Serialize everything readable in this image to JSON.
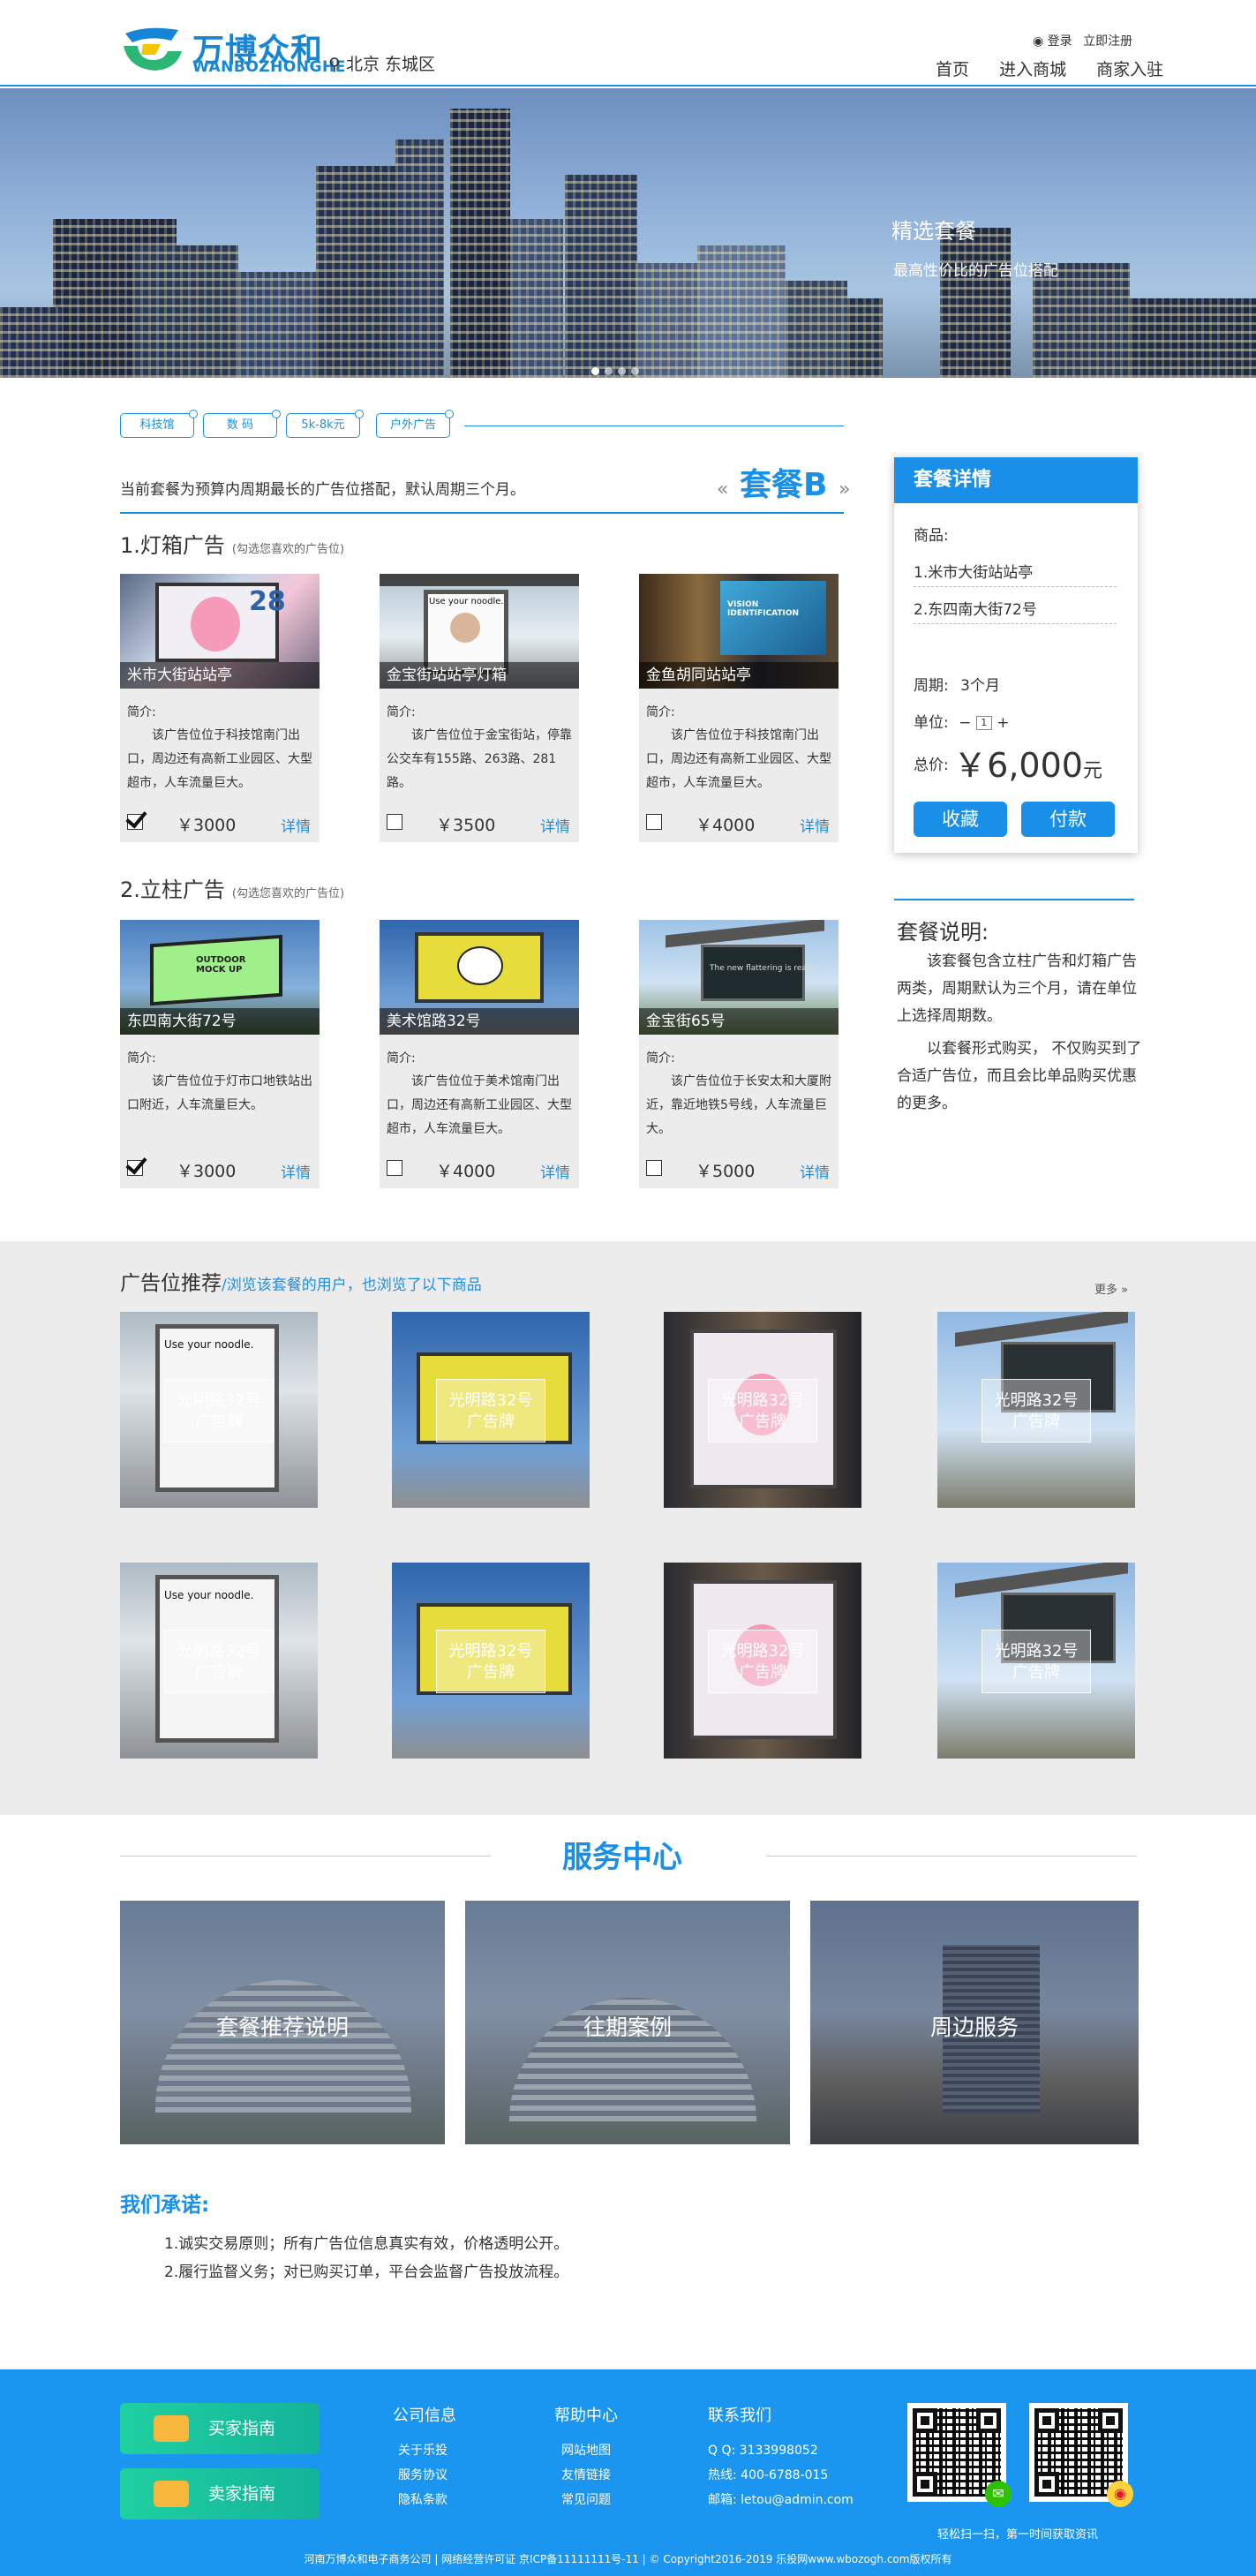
{
  "header": {
    "logo_cn": "万博众和",
    "logo_en": "WANBOZHONGHE",
    "location": "北京 东城区",
    "login": "登录",
    "register": "立即注册",
    "nav": [
      "首页",
      "进入商城",
      "商家入驻"
    ]
  },
  "banner": {
    "title": "精选套餐",
    "subtitle": "最高性价比的广告位搭配"
  },
  "tags": [
    "科技馆",
    "数 码",
    "5k-8k元",
    "户外广告"
  ],
  "package": {
    "intro": "当前套餐为预算内周期最长的广告位搭配，默认周期三个月。",
    "name": "套餐B",
    "quote_left": "«",
    "quote_right": "»"
  },
  "section1": {
    "title": "1.灯箱广告",
    "hint": "(勾选您喜欢的广告位)",
    "cards": [
      {
        "caption": "米市大街站站亭",
        "label": "简介:",
        "desc": "该广告位位于科技馆南门出口，周边还有高新工业园区、大型超市，人车流量巨大。",
        "price": "￥3000",
        "more": "详情",
        "checked": true
      },
      {
        "caption": "金宝街站站亭灯箱",
        "label": "简介:",
        "desc": "该广告位位于金宝街站，停靠公交车有155路、263路、281路。",
        "price": "￥3500",
        "more": "详情",
        "checked": false
      },
      {
        "caption": "金鱼胡同站站亭",
        "label": "简介:",
        "desc": "该广告位位于科技馆南门出口，周边还有高新工业园区、大型超市，人车流量巨大。",
        "price": "￥4000",
        "more": "详情",
        "checked": false
      }
    ]
  },
  "section2": {
    "title": "2.立柱广告",
    "hint": "(勾选您喜欢的广告位)",
    "cards": [
      {
        "caption": "东四南大街72号",
        "label": "简介:",
        "desc": "该广告位位于灯市口地铁站出口附近，人车流量巨大。",
        "price": "￥3000",
        "more": "详情",
        "checked": true
      },
      {
        "caption": "美术馆路32号",
        "label": "简介:",
        "desc": "该广告位位于美术馆南门出口，周边还有高新工业园区、大型超市，人车流量巨大。",
        "price": "￥4000",
        "more": "详情",
        "checked": false
      },
      {
        "caption": "金宝街65号",
        "label": "简介:",
        "desc": "该广告位位于长安太和大厦附近，靠近地铁5号线，人车流量巨大。",
        "price": "￥5000",
        "more": "详情",
        "checked": false
      }
    ]
  },
  "detail": {
    "title": "套餐详情",
    "goods_label": "商品:",
    "goods": [
      "1.米市大街站站亭",
      "2.东四南大街72号"
    ],
    "period_label": "周期:",
    "period": "3个月",
    "unit_label": "单位:",
    "unit_minus": "−",
    "unit_value": "1",
    "unit_plus": "+",
    "total_label": "总价:",
    "total": "￥6,000",
    "total_unit": "元",
    "collect": "收藏",
    "pay": "付款"
  },
  "notes": {
    "title": "套餐说明:",
    "p1": "该套餐包含立柱广告和灯箱广告两类，周期默认为三个月，请在单位上选择周期数。",
    "p2": "以套餐形式购买， 不仅购买到了合适广告位，而且会比单品购买优惠的更多。"
  },
  "recommend": {
    "title": "广告位推荐",
    "subtitle": "/浏览该套餐的用户，也浏览了以下商品",
    "more": "更多 »",
    "items": [
      {
        "line1": "光明路32号",
        "line2": "广告牌"
      },
      {
        "line1": "光明路32号",
        "line2": "广告牌"
      },
      {
        "line1": "光明路32号",
        "line2": "广告牌"
      },
      {
        "line1": "光明路32号",
        "line2": "广告牌"
      },
      {
        "line1": "光明路32号",
        "line2": "广告牌"
      },
      {
        "line1": "光明路32号",
        "line2": "广告牌"
      },
      {
        "line1": "光明路32号",
        "line2": "广告牌"
      },
      {
        "line1": "光明路32号",
        "line2": "广告牌"
      }
    ]
  },
  "service": {
    "title": "服务中心",
    "items": [
      "套餐推荐说明",
      "往期案例",
      "周边服务"
    ]
  },
  "promise": {
    "title": "我们承诺:",
    "items": [
      "1.诚实交易原则；所有广告位信息真实有效，价格透明公开。",
      "2.履行监督义务；对已购买订单，平台会监督广告投放流程。"
    ]
  },
  "footer": {
    "buyer_guide": "买家指南",
    "seller_guide": "卖家指南",
    "col1": {
      "title": "公司信息",
      "items": [
        "关于乐投",
        "服务协议",
        "隐私条款"
      ]
    },
    "col2": {
      "title": "帮助中心",
      "items": [
        "网站地图",
        "友情链接",
        "常见问题"
      ]
    },
    "col3": {
      "title": "联系我们",
      "items": [
        "Q Q:  3133998052",
        "热线:  400-6788-015",
        "邮箱:  letou@admin.com"
      ]
    },
    "qr_note": "轻松扫一扫，第一时间获取资讯",
    "copyright": "河南万博众和电子商务公司 | 网络经营许可证 京ICP备11111111号-11 | © Copyright2016-2019  乐投网www.wbozogh.com版权所有"
  },
  "colors": {
    "accent": "#1a8fe8",
    "footer": "#1a95f0",
    "guide_button": "#1fd0a0"
  },
  "icons": [
    "logo-mark-icon",
    "location-pin-icon",
    "user-icon",
    "checkbox-icon",
    "wechat-icon",
    "weibo-icon",
    "buy-icon",
    "shop-icon"
  ]
}
